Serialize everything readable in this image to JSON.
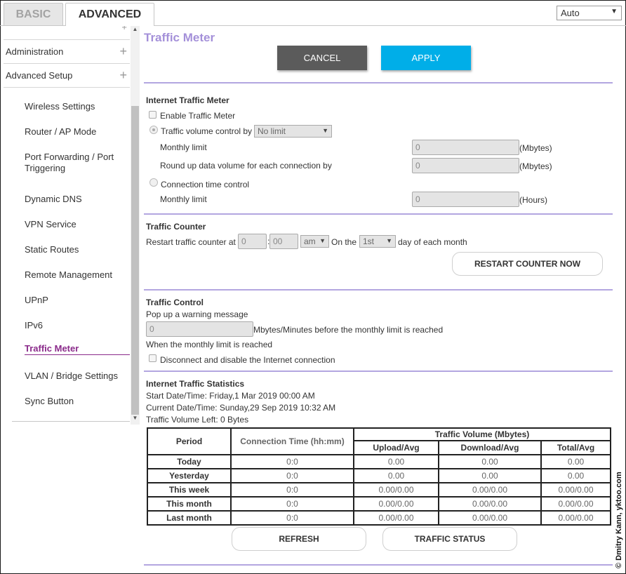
{
  "tabs": {
    "basic": "BASIC",
    "advanced": "ADVANCED"
  },
  "language": {
    "selected": "Auto"
  },
  "sidebar": {
    "partial_top": "",
    "sections": [
      {
        "label": "Administration"
      },
      {
        "label": "Advanced Setup"
      }
    ],
    "items": [
      {
        "label": "Wireless Settings"
      },
      {
        "label": "Router / AP Mode"
      },
      {
        "label": "Port Forwarding / Port Triggering"
      },
      {
        "label": "Dynamic DNS"
      },
      {
        "label": "VPN Service"
      },
      {
        "label": "Static Routes"
      },
      {
        "label": "Remote Management"
      },
      {
        "label": "UPnP"
      },
      {
        "label": "IPv6"
      },
      {
        "label": "Traffic Meter"
      },
      {
        "label": "VLAN / Bridge Settings"
      },
      {
        "label": "Sync Button"
      }
    ]
  },
  "page": {
    "title": "Traffic Meter",
    "cancel": "CANCEL",
    "apply": "APPLY"
  },
  "meter": {
    "heading": "Internet Traffic Meter",
    "enable": "Enable Traffic Meter",
    "volume_control": "Traffic volume control by",
    "volume_select": "No limit",
    "monthly_limit": "Monthly limit",
    "monthly_limit_value": "0",
    "mbytes": "(Mbytes)",
    "roundup": "Round up data volume for each connection by",
    "roundup_value": "0",
    "time_control": "Connection time control",
    "monthly_limit2": "Monthly limit",
    "monthly_limit2_value": "0",
    "hours": "(Hours)"
  },
  "counter": {
    "heading": "Traffic Counter",
    "restart_at": "Restart traffic counter at",
    "hour": "0",
    "colon": ":",
    "minute": "00",
    "ampm": "am",
    "on_the": "On the",
    "day": "1st",
    "day_suffix": "day of each month",
    "restart_button": "RESTART COUNTER NOW"
  },
  "control": {
    "heading": "Traffic Control",
    "popup": "Pop up a warning message",
    "warn_value": "0",
    "warn_suffix": "Mbytes/Minutes before the monthly limit is reached",
    "when_reached": "When the monthly limit is reached",
    "disconnect": "Disconnect and disable the Internet connection"
  },
  "stats": {
    "heading": "Internet Traffic Statistics",
    "start": "Start Date/Time: Friday,1 Mar 2019 00:00 AM",
    "current": "Current Date/Time: Sunday,29 Sep 2019 10:32 AM",
    "left": "Traffic Volume Left: 0 Bytes",
    "headers": {
      "period": "Period",
      "conn_time": "Connection Time (hh:mm)",
      "volume": "Traffic Volume (Mbytes)",
      "upload": "Upload/Avg",
      "download": "Download/Avg",
      "total": "Total/Avg"
    },
    "rows": [
      {
        "period": "Today",
        "time": "0:0",
        "up": "0.00",
        "down": "0.00",
        "total": "0.00"
      },
      {
        "period": "Yesterday",
        "time": "0:0",
        "up": "0.00",
        "down": "0.00",
        "total": "0.00"
      },
      {
        "period": "This week",
        "time": "0:0",
        "up": "0.00/0.00",
        "down": "0.00/0.00",
        "total": "0.00/0.00"
      },
      {
        "period": "This month",
        "time": "0:0",
        "up": "0.00/0.00",
        "down": "0.00/0.00",
        "total": "0.00/0.00"
      },
      {
        "period": "Last month",
        "time": "0:0",
        "up": "0.00/0.00",
        "down": "0.00/0.00",
        "total": "0.00/0.00"
      }
    ],
    "refresh": "REFRESH",
    "traffic_status": "TRAFFIC STATUS"
  },
  "watermark": "© Dmitry Kann, yktoo.com",
  "colors": {
    "accent": "#a490d9",
    "apply": "#00aee8",
    "cancel": "#5b5b5b",
    "active_nav": "#8a2a8a"
  }
}
